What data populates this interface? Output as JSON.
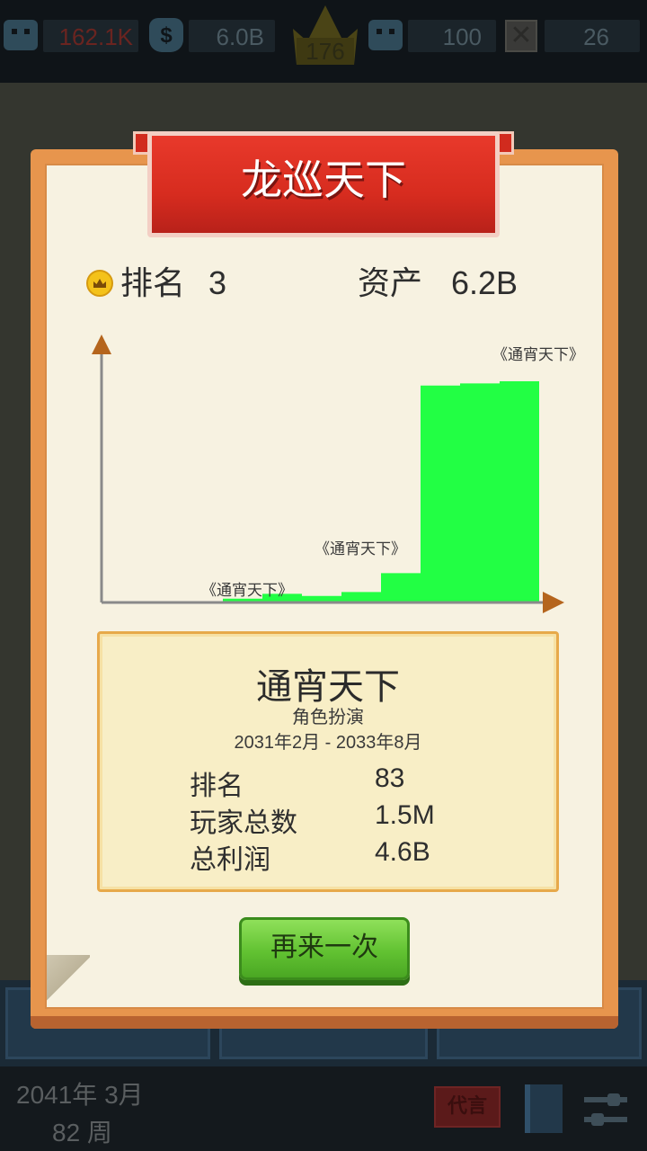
{
  "status_bar": {
    "fans": "162.1K",
    "money": "6.0B",
    "crown_level": "176",
    "staff": "100",
    "blocked": "26"
  },
  "dialog": {
    "title": "龙巡天下",
    "rank_label": "排名",
    "rank_value": "3",
    "assets_label": "资产",
    "assets_value": "6.2B",
    "again_button": "再来一次"
  },
  "chart_data": {
    "type": "area",
    "color": "#22ff44",
    "annotations": [
      "《通宵天下》",
      "《通宵天下》",
      "《通宵天下》"
    ],
    "x": [
      0,
      10,
      20,
      30,
      40,
      50,
      60,
      70,
      80,
      90,
      100
    ],
    "values": [
      0.0,
      0.6,
      1.8,
      4.0,
      3.0,
      4.8,
      13.5,
      100,
      101,
      102,
      101
    ]
  },
  "game_info": {
    "name": "通宵天下",
    "genre": "角色扮演",
    "period": "2031年2月 - 2033年8月",
    "rows": [
      {
        "label": "排名",
        "value": "83"
      },
      {
        "label": "玩家总数",
        "value": "1.5M"
      },
      {
        "label": "总利润",
        "value": "4.6B"
      }
    ]
  },
  "bottom_bar": {
    "date": "2041年 3月",
    "week": "82 周",
    "proxy_label": "代言"
  },
  "colors": {
    "banner_red": "#e8392b",
    "panel_orange": "#e7954d",
    "button_green": "#62c232",
    "chart_green": "#22ff44"
  }
}
